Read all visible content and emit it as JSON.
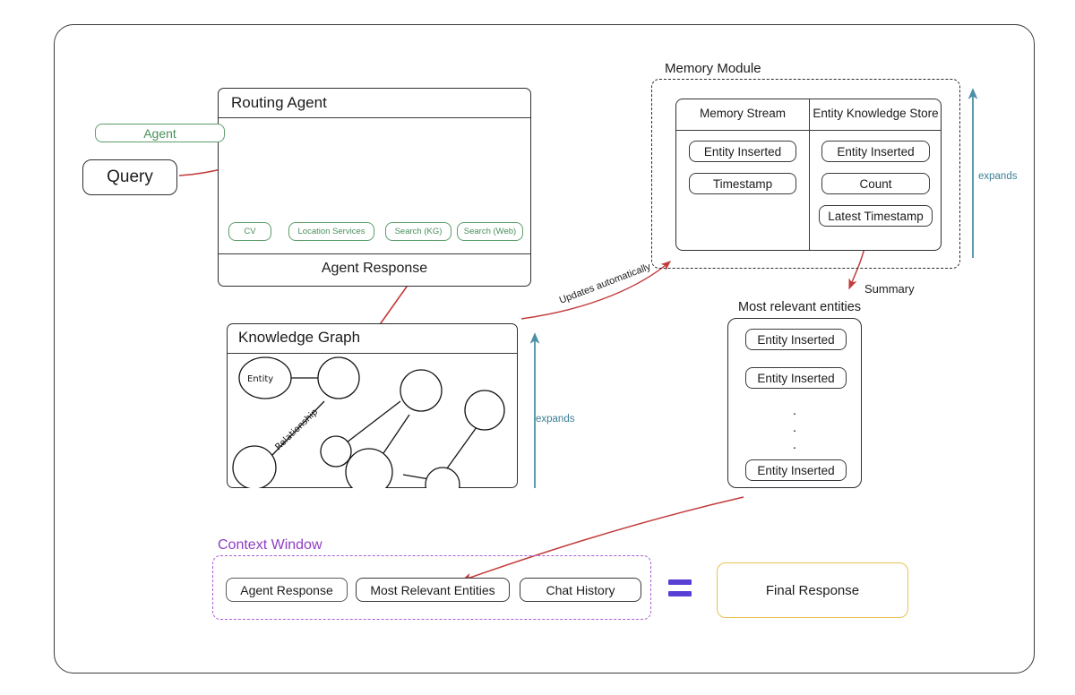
{
  "query": {
    "label": "Query"
  },
  "routing_agent": {
    "title": "Routing Agent",
    "agent_node": "Agent",
    "tools": [
      {
        "label": "CV"
      },
      {
        "label": "Location Services"
      },
      {
        "label": "Search (KG)"
      },
      {
        "label": "Search (Web)"
      }
    ],
    "response_label": "Agent Response"
  },
  "knowledge_graph": {
    "title": "Knowledge Graph",
    "entity_label": "Entity",
    "relationship_label": "Relationship",
    "expands_label": "expands"
  },
  "memory_module": {
    "title": "Memory Module",
    "expands_label": "expands",
    "summary_label": "Summary",
    "updates_label": "Updates automatically",
    "columns": [
      {
        "header": "Memory Stream",
        "items": [
          "Entity Inserted",
          "Timestamp"
        ]
      },
      {
        "header": "Entity Knowledge Store",
        "items": [
          "Entity Inserted",
          "Count",
          "Latest Timestamp"
        ]
      }
    ]
  },
  "most_relevant_entities": {
    "title": "Most relevant entities",
    "items": [
      "Entity Inserted",
      "Entity Inserted",
      "Entity Inserted"
    ],
    "ellipsis": "."
  },
  "context_window": {
    "title": "Context Window",
    "items": [
      "Agent Response",
      "Most Relevant Entities",
      "Chat History"
    ]
  },
  "final_response": {
    "label": "Final Response"
  },
  "colors": {
    "frame": "#3a3a3e",
    "green": "#5c9e6b",
    "red_arrow": "#c23b3b",
    "teal_arrow": "#4d8fa6",
    "purple": "#a95fd4",
    "equals": "#5a3fd4",
    "amber": "#e9c253"
  }
}
